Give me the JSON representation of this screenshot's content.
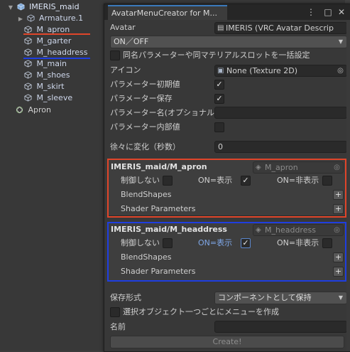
{
  "hierarchy": {
    "items": [
      {
        "label": "IMERIS_maid"
      },
      {
        "label": "Armature.1"
      },
      {
        "label": "M_apron"
      },
      {
        "label": "M_garter"
      },
      {
        "label": "M_headdress"
      },
      {
        "label": "M_main"
      },
      {
        "label": "M_shoes"
      },
      {
        "label": "M_skirt"
      },
      {
        "label": "M_sleeve"
      },
      {
        "label": "Apron"
      }
    ]
  },
  "window": {
    "title": "AvatarMenuCreator for M...",
    "avatar_label": "Avatar",
    "avatar_value": "IMERIS (VRC Avatar Descrip",
    "mode_value": "ON／OFF",
    "same_param_label": "同名パラメーターや同マテリアルスロットを一括設定",
    "icon_label": "アイコン",
    "icon_value": "None (Texture 2D)",
    "param_default_label": "パラメーター初期値",
    "param_save_label": "パラメーター保存",
    "param_name_label": "パラメーター名(オプショナル)",
    "param_internal_label": "パラメーター内部値",
    "gradual_label": "徐々に変化（秒数）",
    "gradual_value": "0",
    "save_format_label": "保存形式",
    "save_format_value": "コンポーネントとして保持",
    "per_object_label": "選択オブジェクト一つごとにメニューを作成",
    "name_label": "名前",
    "create_label": "Create!"
  },
  "sections": [
    {
      "title": "IMERIS_maid/M_apron",
      "ref": "M_apron",
      "no_control": "制御しない",
      "on_show": "ON=表示",
      "on_hide": "ON=非表示",
      "blendshapes": "BlendShapes",
      "shader_params": "Shader Parameters",
      "plus": "+"
    },
    {
      "title": "IMERIS_maid/M_headdress",
      "ref": "M_headdress",
      "no_control": "制御しない",
      "on_show": "ON=表示",
      "on_hide": "ON=非表示",
      "blendshapes": "BlendShapes",
      "shader_params": "Shader Parameters",
      "plus": "+"
    }
  ],
  "colors": {
    "highlight_red": "#e0452a",
    "highlight_blue": "#1f3ee0",
    "accent_tab": "#3a79bb"
  }
}
